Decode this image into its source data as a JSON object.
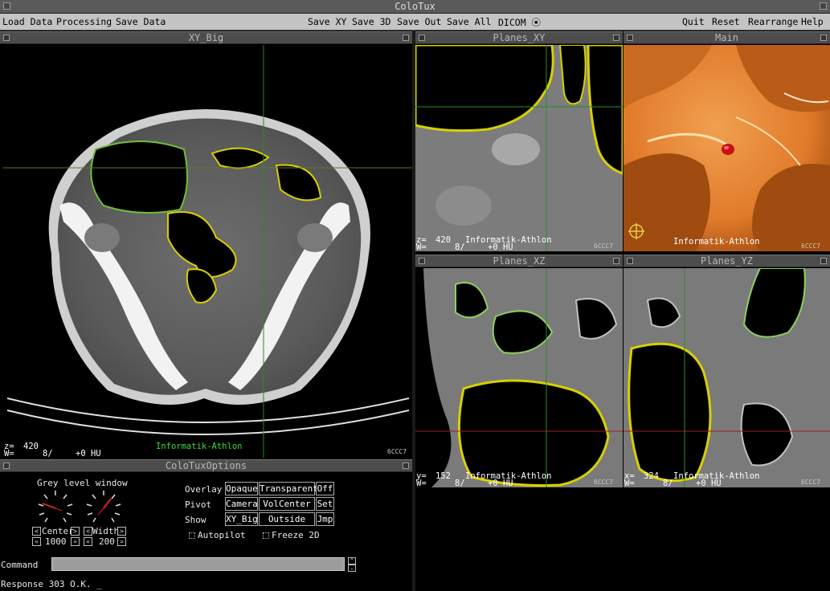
{
  "window": {
    "title": "ColoTux"
  },
  "menu": {
    "left": [
      "Load Data",
      "Processing",
      "Save Data"
    ],
    "center": [
      "Save XY",
      "Save 3D",
      "Save Out",
      "Save All",
      "DICOM ⦿"
    ],
    "right": [
      "Quit",
      "Reset",
      "Rearrange",
      "Help"
    ]
  },
  "panels": {
    "xy_big": {
      "title": "XY_Big",
      "z_label": "z=",
      "z_value": "420",
      "w_label": "W=",
      "w_value": "8/",
      "hu": "+0 HU",
      "host": "Informatik-Athlon",
      "corner": "6CCC7"
    },
    "planes_xy": {
      "title": "Planes_XY",
      "z_label": "z=",
      "z_value": "420",
      "w_label": "W=",
      "w_value": "8/",
      "hu": "+0 HU",
      "host": "Informatik-Athlon",
      "corner": "6CCC7"
    },
    "main": {
      "title": "Main",
      "host": "Informatik-Athlon",
      "corner": "6CCC7"
    },
    "planes_xz": {
      "title": "Planes_XZ",
      "z_label": "y=",
      "z_value": "152",
      "w_label": "W=",
      "w_value": "8/",
      "hu": "+0 HU",
      "host": "Informatik-Athlon",
      "corner": "6CCC7"
    },
    "planes_yz": {
      "title": "Planes_YZ",
      "z_label": "x=",
      "z_value": "324",
      "w_label": "W=",
      "w_value": "8/",
      "hu": "+0 HU",
      "host": "Informatik-Athlon",
      "corner": "6CCC7"
    }
  },
  "options": {
    "title": "ColoTuxOptions",
    "grey_level_label": "Grey level window",
    "center_label": "Center",
    "center_value": "1000",
    "width_label": "Width",
    "width_value": "200",
    "rows": [
      {
        "label": "Overlay",
        "cells": [
          "Opaque",
          "Transparent",
          "Off"
        ]
      },
      {
        "label": "Pivot",
        "cells": [
          "Camera",
          "VolCenter",
          "Set"
        ]
      },
      {
        "label": "Show",
        "cells": [
          "XY_Big",
          "Outside",
          "Jmp"
        ]
      }
    ],
    "autopilot_label": "Autopilot",
    "freeze_label": "Freeze 2D",
    "command_label": "Command",
    "command_value": "",
    "response": "Response 303 O.K. _"
  },
  "colors": {
    "menu_bg": "#c4c4c4",
    "header_bg": "#4d4d4d",
    "overlay_green": "#3cdc3c",
    "surface_orange": "#e07a2a",
    "colon_outline": "#d8d000"
  }
}
